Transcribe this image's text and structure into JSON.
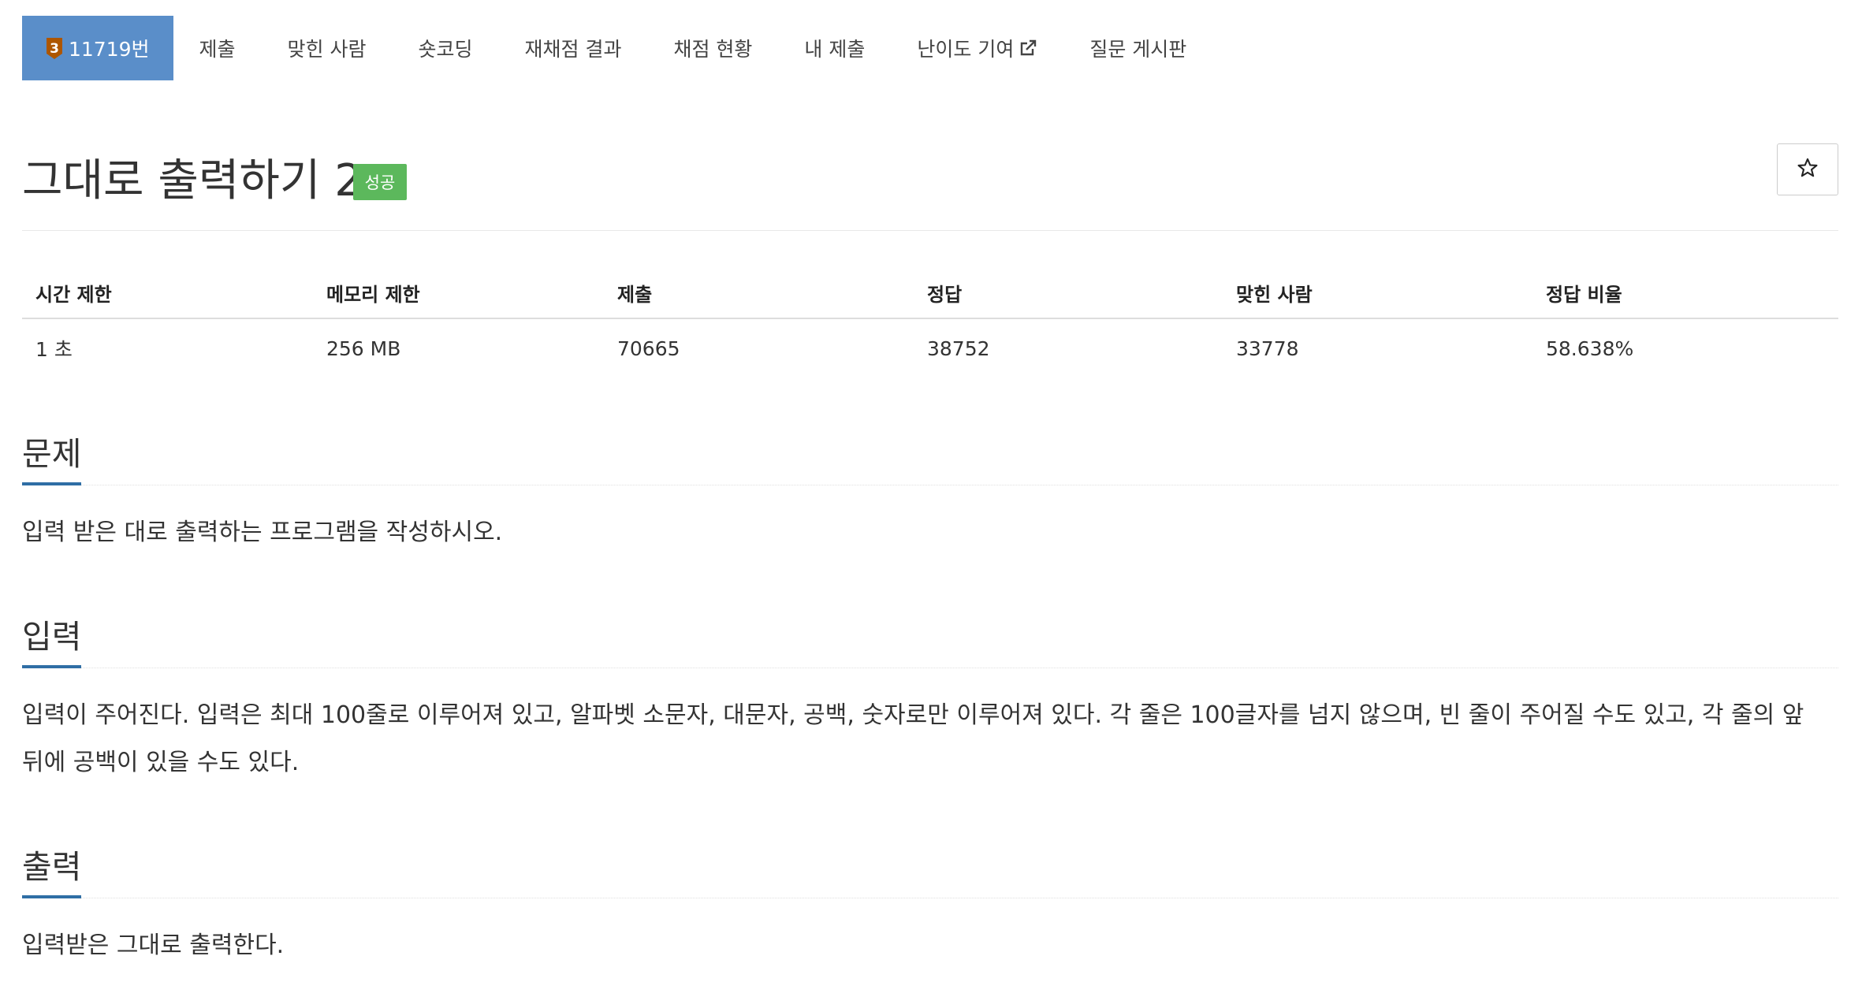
{
  "nav": {
    "tabs": [
      {
        "label": "11719번",
        "badge": "3",
        "active": true
      },
      {
        "label": "제출"
      },
      {
        "label": "맞힌 사람"
      },
      {
        "label": "숏코딩"
      },
      {
        "label": "재채점 결과"
      },
      {
        "label": "채점 현황"
      },
      {
        "label": "내 제출"
      },
      {
        "label": "난이도 기여",
        "external": true
      },
      {
        "label": "질문 게시판"
      }
    ]
  },
  "problem": {
    "title": "그대로 출력하기 2",
    "result_badge": "성공",
    "star_label": "☆"
  },
  "info": {
    "headers": [
      "시간 제한",
      "메모리 제한",
      "제출",
      "정답",
      "맞힌 사람",
      "정답 비율"
    ],
    "values": [
      "1 초",
      "256 MB",
      "70665",
      "38752",
      "33778",
      "58.638%"
    ]
  },
  "sections": {
    "description": {
      "heading": "문제",
      "text": "입력 받은 대로 출력하는 프로그램을 작성하시오."
    },
    "input": {
      "heading": "입력",
      "text": "입력이 주어진다. 입력은 최대 100줄로 이루어져 있고, 알파벳 소문자, 대문자, 공백, 숫자로만 이루어져 있다. 각 줄은 100글자를 넘지 않으며, 빈 줄이 주어질 수도 있고, 각 줄의 앞 뒤에 공백이 있을 수도 있다."
    },
    "output": {
      "heading": "출력",
      "text": "입력받은 그대로 출력한다."
    }
  },
  "colors": {
    "active_tab": "#5a8ec9",
    "tier_badge": "#ad5600",
    "success_badge": "#5cb85c",
    "heading_underline": "#2f6ea5"
  },
  "icons": {
    "tier": "bronze-tier-icon",
    "external": "external-link-icon",
    "star": "star-icon"
  }
}
